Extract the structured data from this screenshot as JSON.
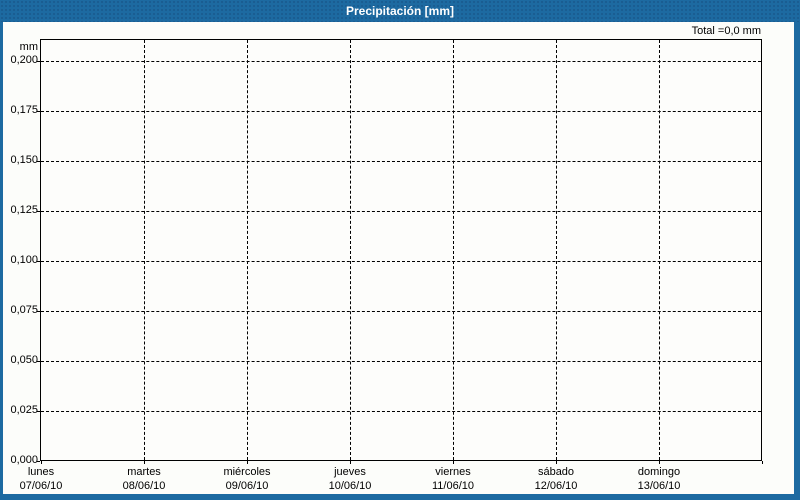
{
  "window": {
    "title": "Precipitación [mm]"
  },
  "summary": {
    "total_label": "Total =0,0 mm"
  },
  "colors": {
    "frame_blue": "#1d6aa1",
    "content_background": "#fcfdfa",
    "plot_background": "#fdfdfb",
    "grid_line": "#000000",
    "text": "#000000",
    "title_text": "#ffffff"
  },
  "chart_data": {
    "type": "bar",
    "title": "Precipitación [mm]",
    "xlabel": "",
    "ylabel": "mm",
    "ylim": [
      0,
      0.21
    ],
    "grid": true,
    "legend": false,
    "y_ticks": [
      {
        "value": 0.2,
        "label": "0,200"
      },
      {
        "value": 0.175,
        "label": "0,175"
      },
      {
        "value": 0.15,
        "label": "0,150"
      },
      {
        "value": 0.125,
        "label": "0,125"
      },
      {
        "value": 0.1,
        "label": "0,100"
      },
      {
        "value": 0.075,
        "label": "0,075"
      },
      {
        "value": 0.05,
        "label": "0,050"
      },
      {
        "value": 0.025,
        "label": "0,025"
      },
      {
        "value": 0.0,
        "label": "0,000"
      }
    ],
    "categories": [
      {
        "day": "lunes",
        "date": "07/06/10"
      },
      {
        "day": "martes",
        "date": "08/06/10"
      },
      {
        "day": "miércoles",
        "date": "09/06/10"
      },
      {
        "day": "jueves",
        "date": "10/06/10"
      },
      {
        "day": "viernes",
        "date": "11/06/10"
      },
      {
        "day": "sábado",
        "date": "12/06/10"
      },
      {
        "day": "domingo",
        "date": "13/06/10"
      }
    ],
    "series": [
      {
        "name": "Precipitación",
        "values": [
          0,
          0,
          0,
          0,
          0,
          0,
          0
        ]
      }
    ],
    "total": "0,0 mm"
  }
}
